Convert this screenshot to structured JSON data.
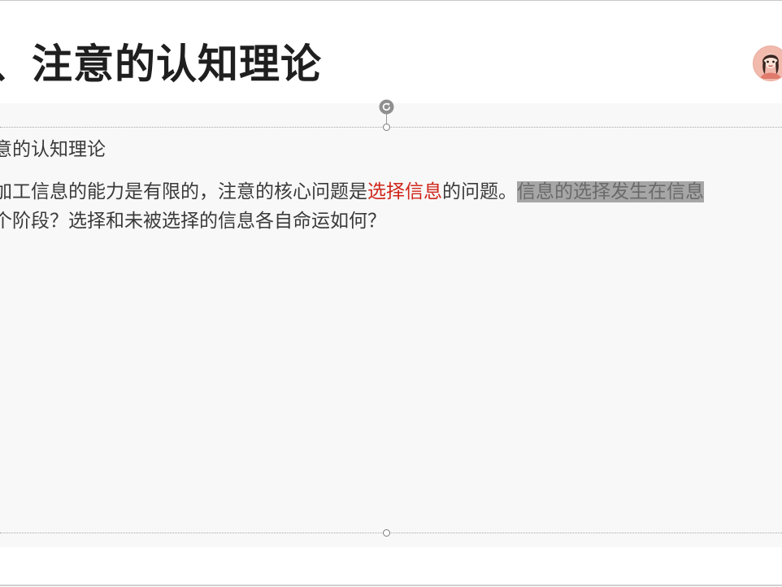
{
  "slide": {
    "title": "、注意的认知理论"
  },
  "textbox": {
    "subheading": "意的认知理论",
    "line1": {
      "before": "加工信息的能力是有限的，注意的核心问题是",
      "emphasis": "选择信息",
      "after": "的问题。",
      "highlighted": "信息的选择发生在信息"
    },
    "line2": "个阶段？选择和未被选择的信息各自命运如何？"
  },
  "colors": {
    "emphasis": "#d0251a",
    "highlight": "#a6a6a6",
    "title": "#1f1f1f"
  },
  "icons": {
    "rotate": "rotate-handle-icon",
    "avatar": "presenter-avatar"
  }
}
